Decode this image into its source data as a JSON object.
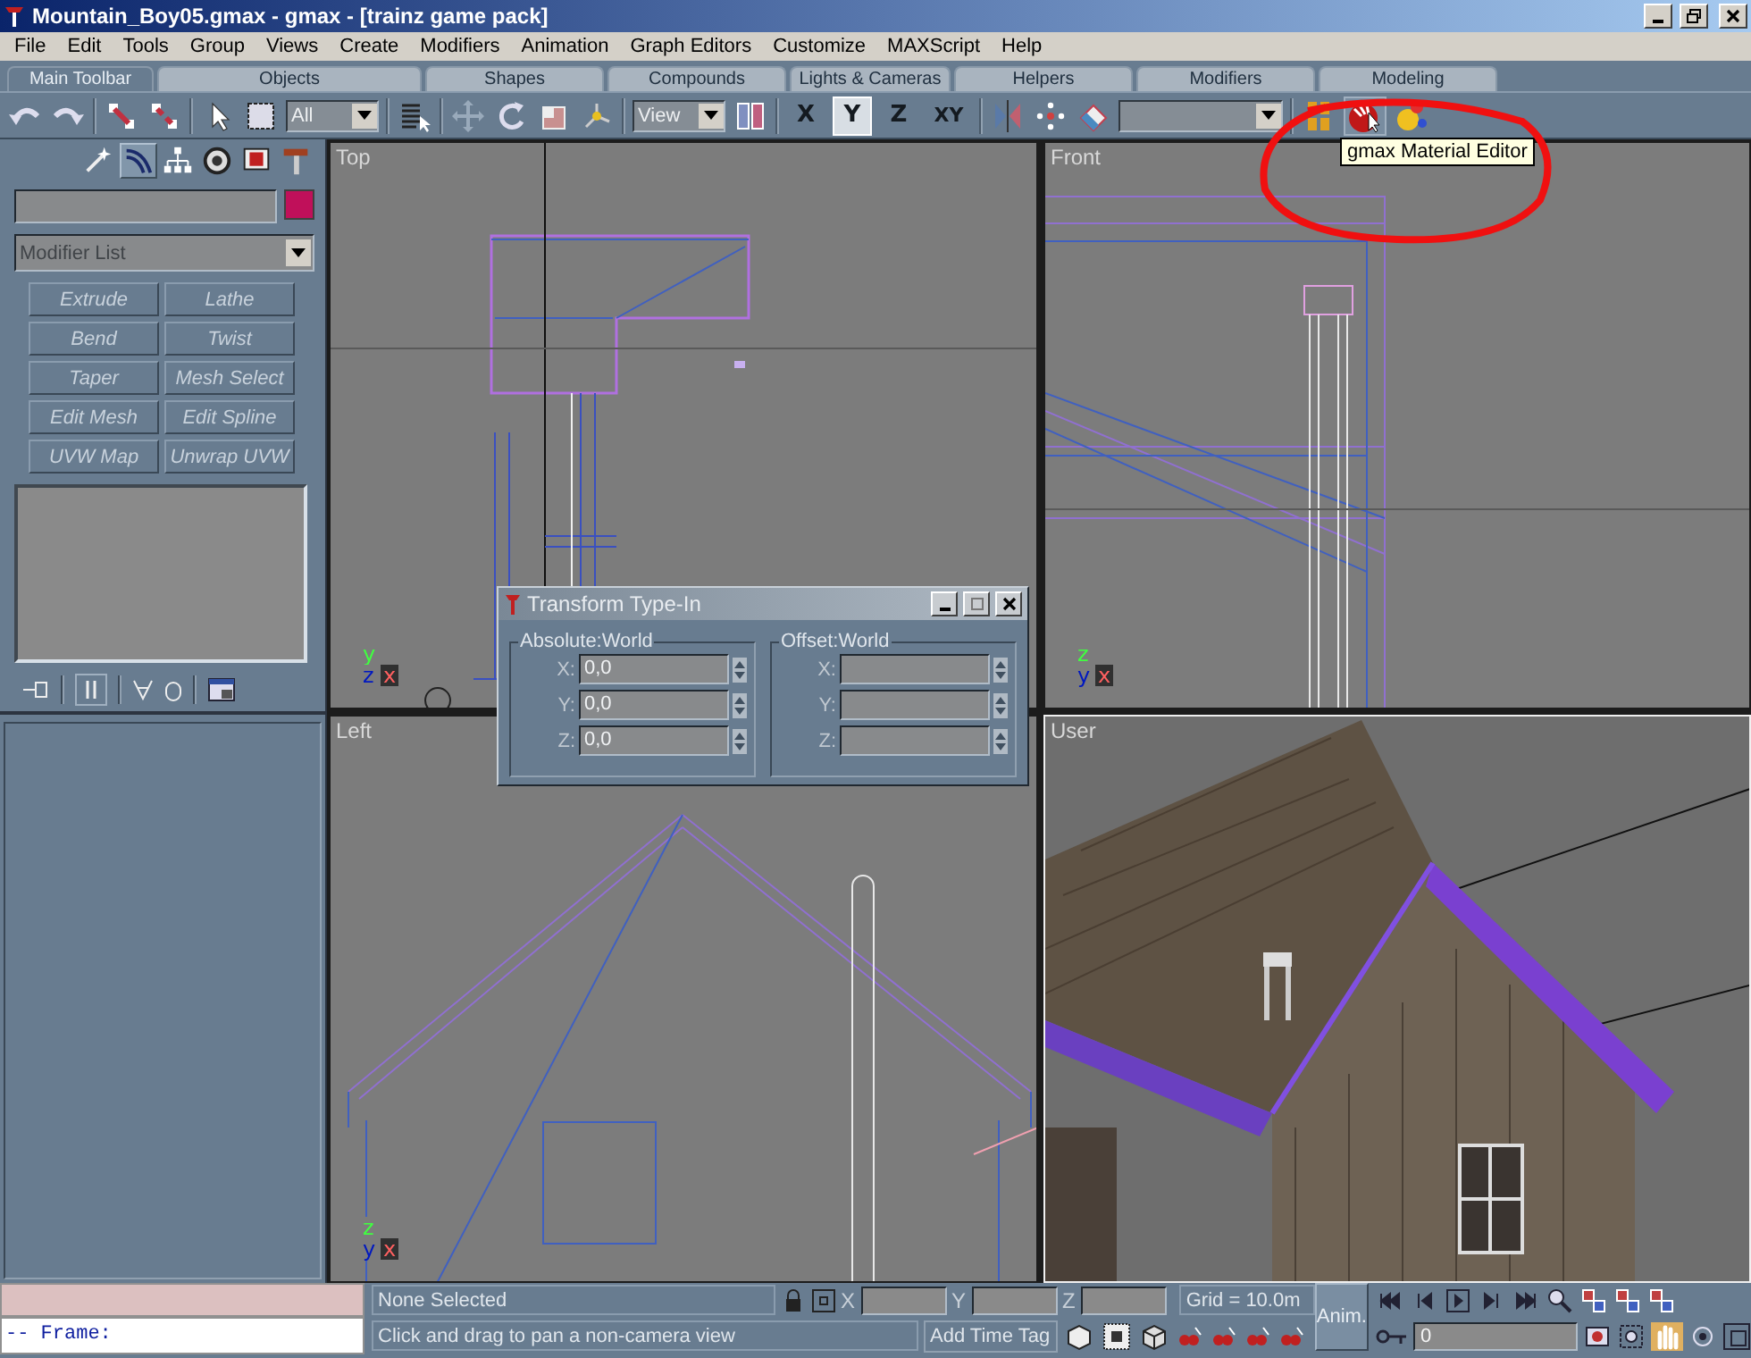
{
  "window": {
    "title": "Mountain_Boy05.gmax - gmax - [trainz game pack]"
  },
  "menu": [
    "File",
    "Edit",
    "Tools",
    "Group",
    "Views",
    "Create",
    "Modifiers",
    "Animation",
    "Graph Editors",
    "Customize",
    "MAXScript",
    "Help"
  ],
  "toolbar_tabs": [
    {
      "label": "Main Toolbar",
      "selected": true
    },
    {
      "label": "Objects",
      "selected": false
    },
    {
      "label": "Shapes",
      "selected": false
    },
    {
      "label": "Compounds",
      "selected": false
    },
    {
      "label": "Lights & Cameras",
      "selected": false
    },
    {
      "label": "Helpers",
      "selected": false
    },
    {
      "label": "Modifiers",
      "selected": false
    },
    {
      "label": "Modeling",
      "selected": false
    }
  ],
  "toolbar": {
    "selection_filter": "All",
    "reference_coordinate": "View",
    "axis_buttons": [
      {
        "label": "X",
        "selected": false
      },
      {
        "label": "Y",
        "selected": true
      },
      {
        "label": "Z",
        "selected": false
      },
      {
        "label": "XY",
        "selected": false
      }
    ]
  },
  "tooltip": "gmax Material Editor",
  "command_panel": {
    "tabs": [
      {
        "kind": "create",
        "selected": false
      },
      {
        "kind": "modify",
        "selected": true
      },
      {
        "kind": "hierarchy",
        "selected": false
      },
      {
        "kind": "motion",
        "selected": false
      },
      {
        "kind": "display",
        "selected": false
      },
      {
        "kind": "utilities",
        "selected": false
      }
    ],
    "modifier_list": "Modifier List",
    "modifier_buttons": [
      {
        "label": "Extrude",
        "disabled": true
      },
      {
        "label": "Lathe",
        "disabled": true
      },
      {
        "label": "Bend",
        "disabled": true
      },
      {
        "label": "Twist",
        "disabled": true
      },
      {
        "label": "Taper",
        "disabled": true
      },
      {
        "label": "Mesh Select",
        "disabled": true
      },
      {
        "label": "Edit Mesh",
        "disabled": true
      },
      {
        "label": "Edit Spline",
        "disabled": true
      },
      {
        "label": "UVW Map",
        "disabled": true
      },
      {
        "label": "Unwrap UVW",
        "disabled": true
      }
    ]
  },
  "viewports": [
    {
      "label": "Top",
      "kind": "top",
      "active": false,
      "axes": [
        "y",
        "z",
        "x"
      ]
    },
    {
      "label": "Front",
      "kind": "front",
      "active": false,
      "axes": [
        "z",
        "y",
        "x"
      ]
    },
    {
      "label": "Left",
      "kind": "left",
      "active": false,
      "axes": [
        "z",
        "y",
        "x"
      ]
    },
    {
      "label": "User",
      "kind": "user",
      "active": true
    }
  ],
  "dialog": {
    "title": "Transform Type-In",
    "groups": [
      {
        "label": "Absolute:World",
        "fields": [
          {
            "axis": "X:",
            "value": "0,0"
          },
          {
            "axis": "Y:",
            "value": "0,0"
          },
          {
            "axis": "Z:",
            "value": "0,0"
          }
        ]
      },
      {
        "label": "Offset:World",
        "fields": [
          {
            "axis": "X:"
          },
          {
            "axis": "Y:"
          },
          {
            "axis": "Z:"
          }
        ]
      }
    ]
  },
  "status_bar": {
    "listener_output": "-- Frame:",
    "selection": "None Selected",
    "prompt": "Click and drag to pan a non-camera view",
    "coordinates": [
      "X",
      "Y",
      "Z"
    ],
    "grid": "Grid = 10.0m",
    "anim_button": "Anim.",
    "time_tag_button": "Add Time Tag",
    "frame": "0"
  }
}
